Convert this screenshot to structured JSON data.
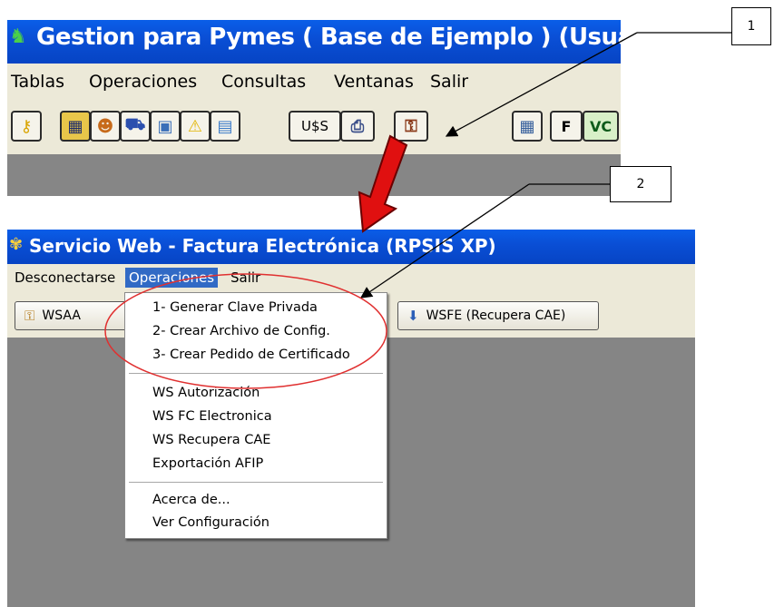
{
  "window1": {
    "title": "Gestion para Pymes ( Base de Ejemplo ) (Usuario: sa",
    "title_icon": "app-logo-icon",
    "menu": [
      "Tablas",
      "Operaciones",
      "Consultas",
      "Ventanas",
      "Salir"
    ],
    "toolbar": {
      "currency_label": "U$S",
      "f_label": "F",
      "vc_label": "VC",
      "icons": [
        "key-icon",
        "save-icon",
        "users-icon",
        "truck-icon",
        "box-icon",
        "warning-icon",
        "chart-icon",
        "currency-button",
        "printer-icon",
        "keys-icon",
        "calculator-icon",
        "invoice-f-icon",
        "vc-icon"
      ]
    }
  },
  "window2": {
    "title": "Servicio Web - Factura Electrónica (RPSIS XP)",
    "title_icon": "service-icon",
    "menu": [
      "Desconectarse",
      "Operaciones",
      "Salir"
    ],
    "active_menu": "Operaciones",
    "toolbar": {
      "wsaa_label": "WSAA",
      "wsfe_label": "WSFE (Recupera CAE)"
    },
    "dropdown": {
      "group1": [
        "1- Generar Clave Privada",
        "2- Crear Archivo de Config.",
        "3- Crear Pedido de Certificado"
      ],
      "group2": [
        "WS Autorización",
        "WS FC Electronica",
        "WS Recupera CAE",
        "Exportación AFIP"
      ],
      "group3": [
        "Acerca de...",
        "Ver Configuración"
      ]
    }
  },
  "callouts": [
    "1",
    "2"
  ],
  "colors": {
    "titlebar": "#0a4fd6",
    "menubar": "#ece9d8",
    "workspace": "#868686",
    "menu_highlight": "#316ac5",
    "ellipse": "#e03030",
    "arrow": "#e01010"
  }
}
